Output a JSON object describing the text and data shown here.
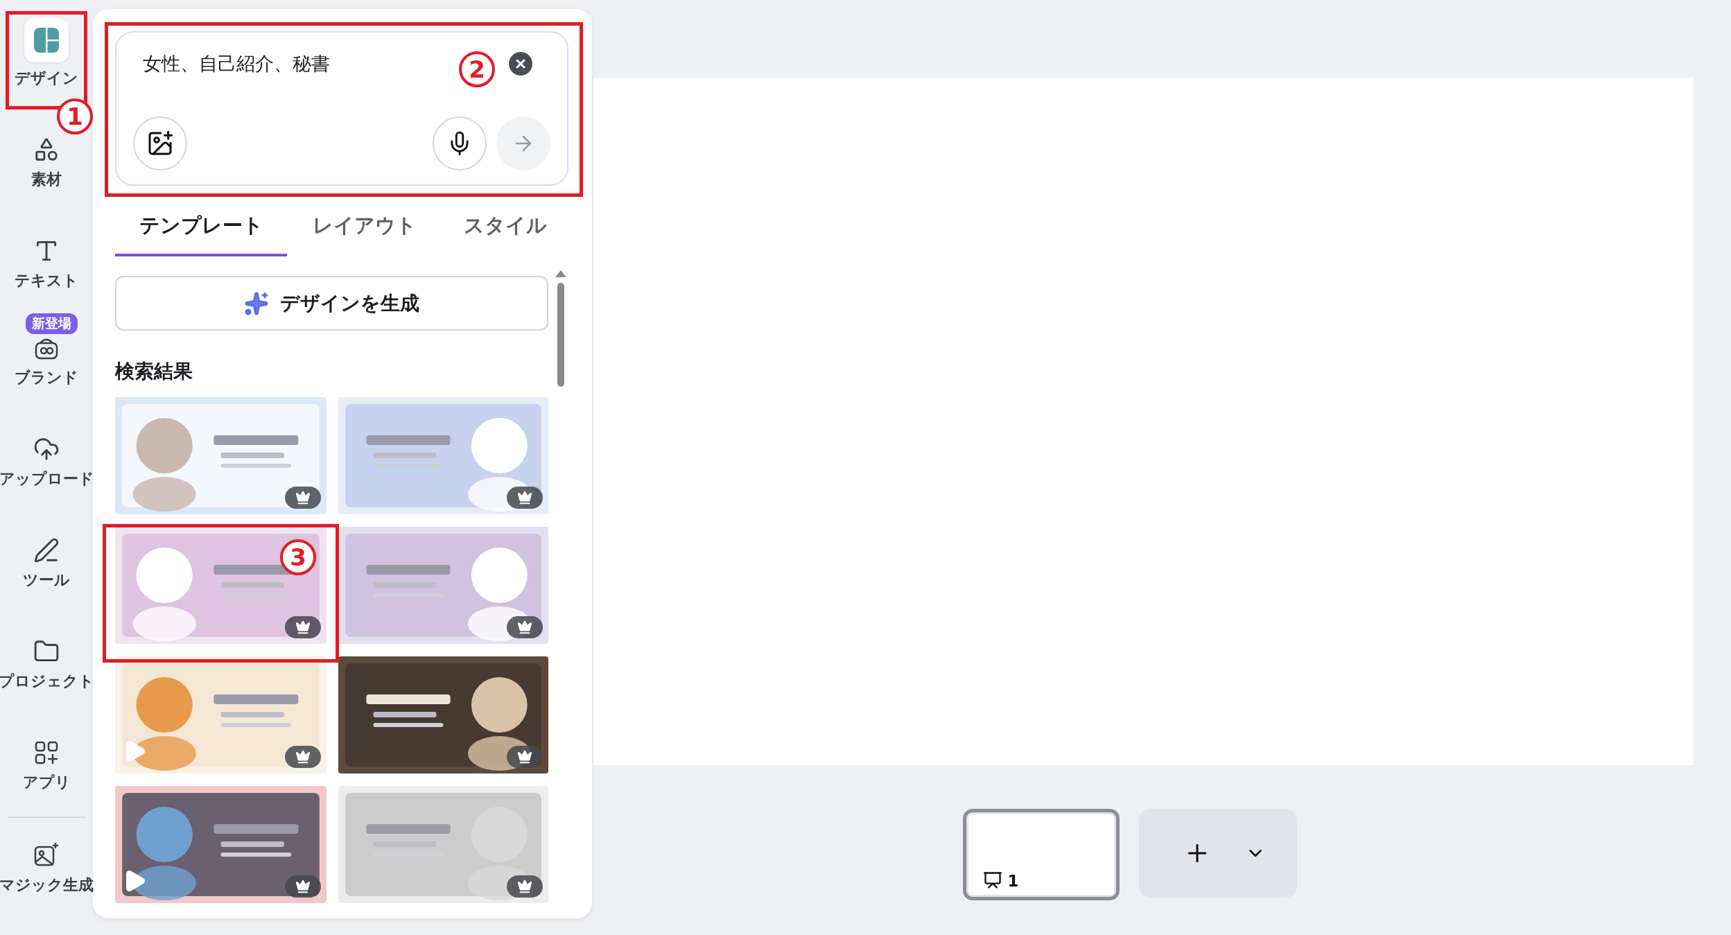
{
  "sidebar": {
    "items": [
      {
        "kind": "design",
        "label": "デザイン",
        "selected": true,
        "annotation": "1"
      },
      {
        "kind": "elements",
        "label": "素材",
        "selected": false
      },
      {
        "kind": "text",
        "label": "テキスト",
        "selected": false
      },
      {
        "kind": "brand",
        "label": "ブランド",
        "selected": false,
        "badge": "新登場"
      },
      {
        "kind": "upload",
        "label": "アップロード",
        "selected": false
      },
      {
        "kind": "tools",
        "label": "ツール",
        "selected": false
      },
      {
        "kind": "projects",
        "label": "プロジェクト",
        "selected": false
      },
      {
        "kind": "apps",
        "label": "アプリ",
        "selected": false
      },
      {
        "kind": "magic",
        "label": "マジック生成",
        "selected": false
      }
    ]
  },
  "panel": {
    "search": {
      "value": "女性、自己紹介、秘書",
      "annotation": "2"
    },
    "tabs": [
      {
        "label": "テンプレート",
        "selected": true
      },
      {
        "label": "レイアウト",
        "selected": false
      },
      {
        "label": "スタイル",
        "selected": false
      }
    ],
    "generate_button": "デザインを生成",
    "results_heading": "検索結果",
    "templates": [
      {
        "kind": "picture",
        "premium": true,
        "video": false
      },
      {
        "kind": "picture",
        "premium": true,
        "video": false
      },
      {
        "kind": "picture",
        "premium": true,
        "video": false,
        "annotation": "3"
      },
      {
        "kind": "picture",
        "premium": true,
        "video": false
      },
      {
        "kind": "picture",
        "premium": true,
        "video": true
      },
      {
        "kind": "picture",
        "premium": true,
        "video": false
      },
      {
        "kind": "picture",
        "premium": true,
        "video": true
      },
      {
        "kind": "picture",
        "premium": true,
        "video": false
      }
    ]
  },
  "pages": [
    {
      "number": "1",
      "selected": true
    }
  ]
}
